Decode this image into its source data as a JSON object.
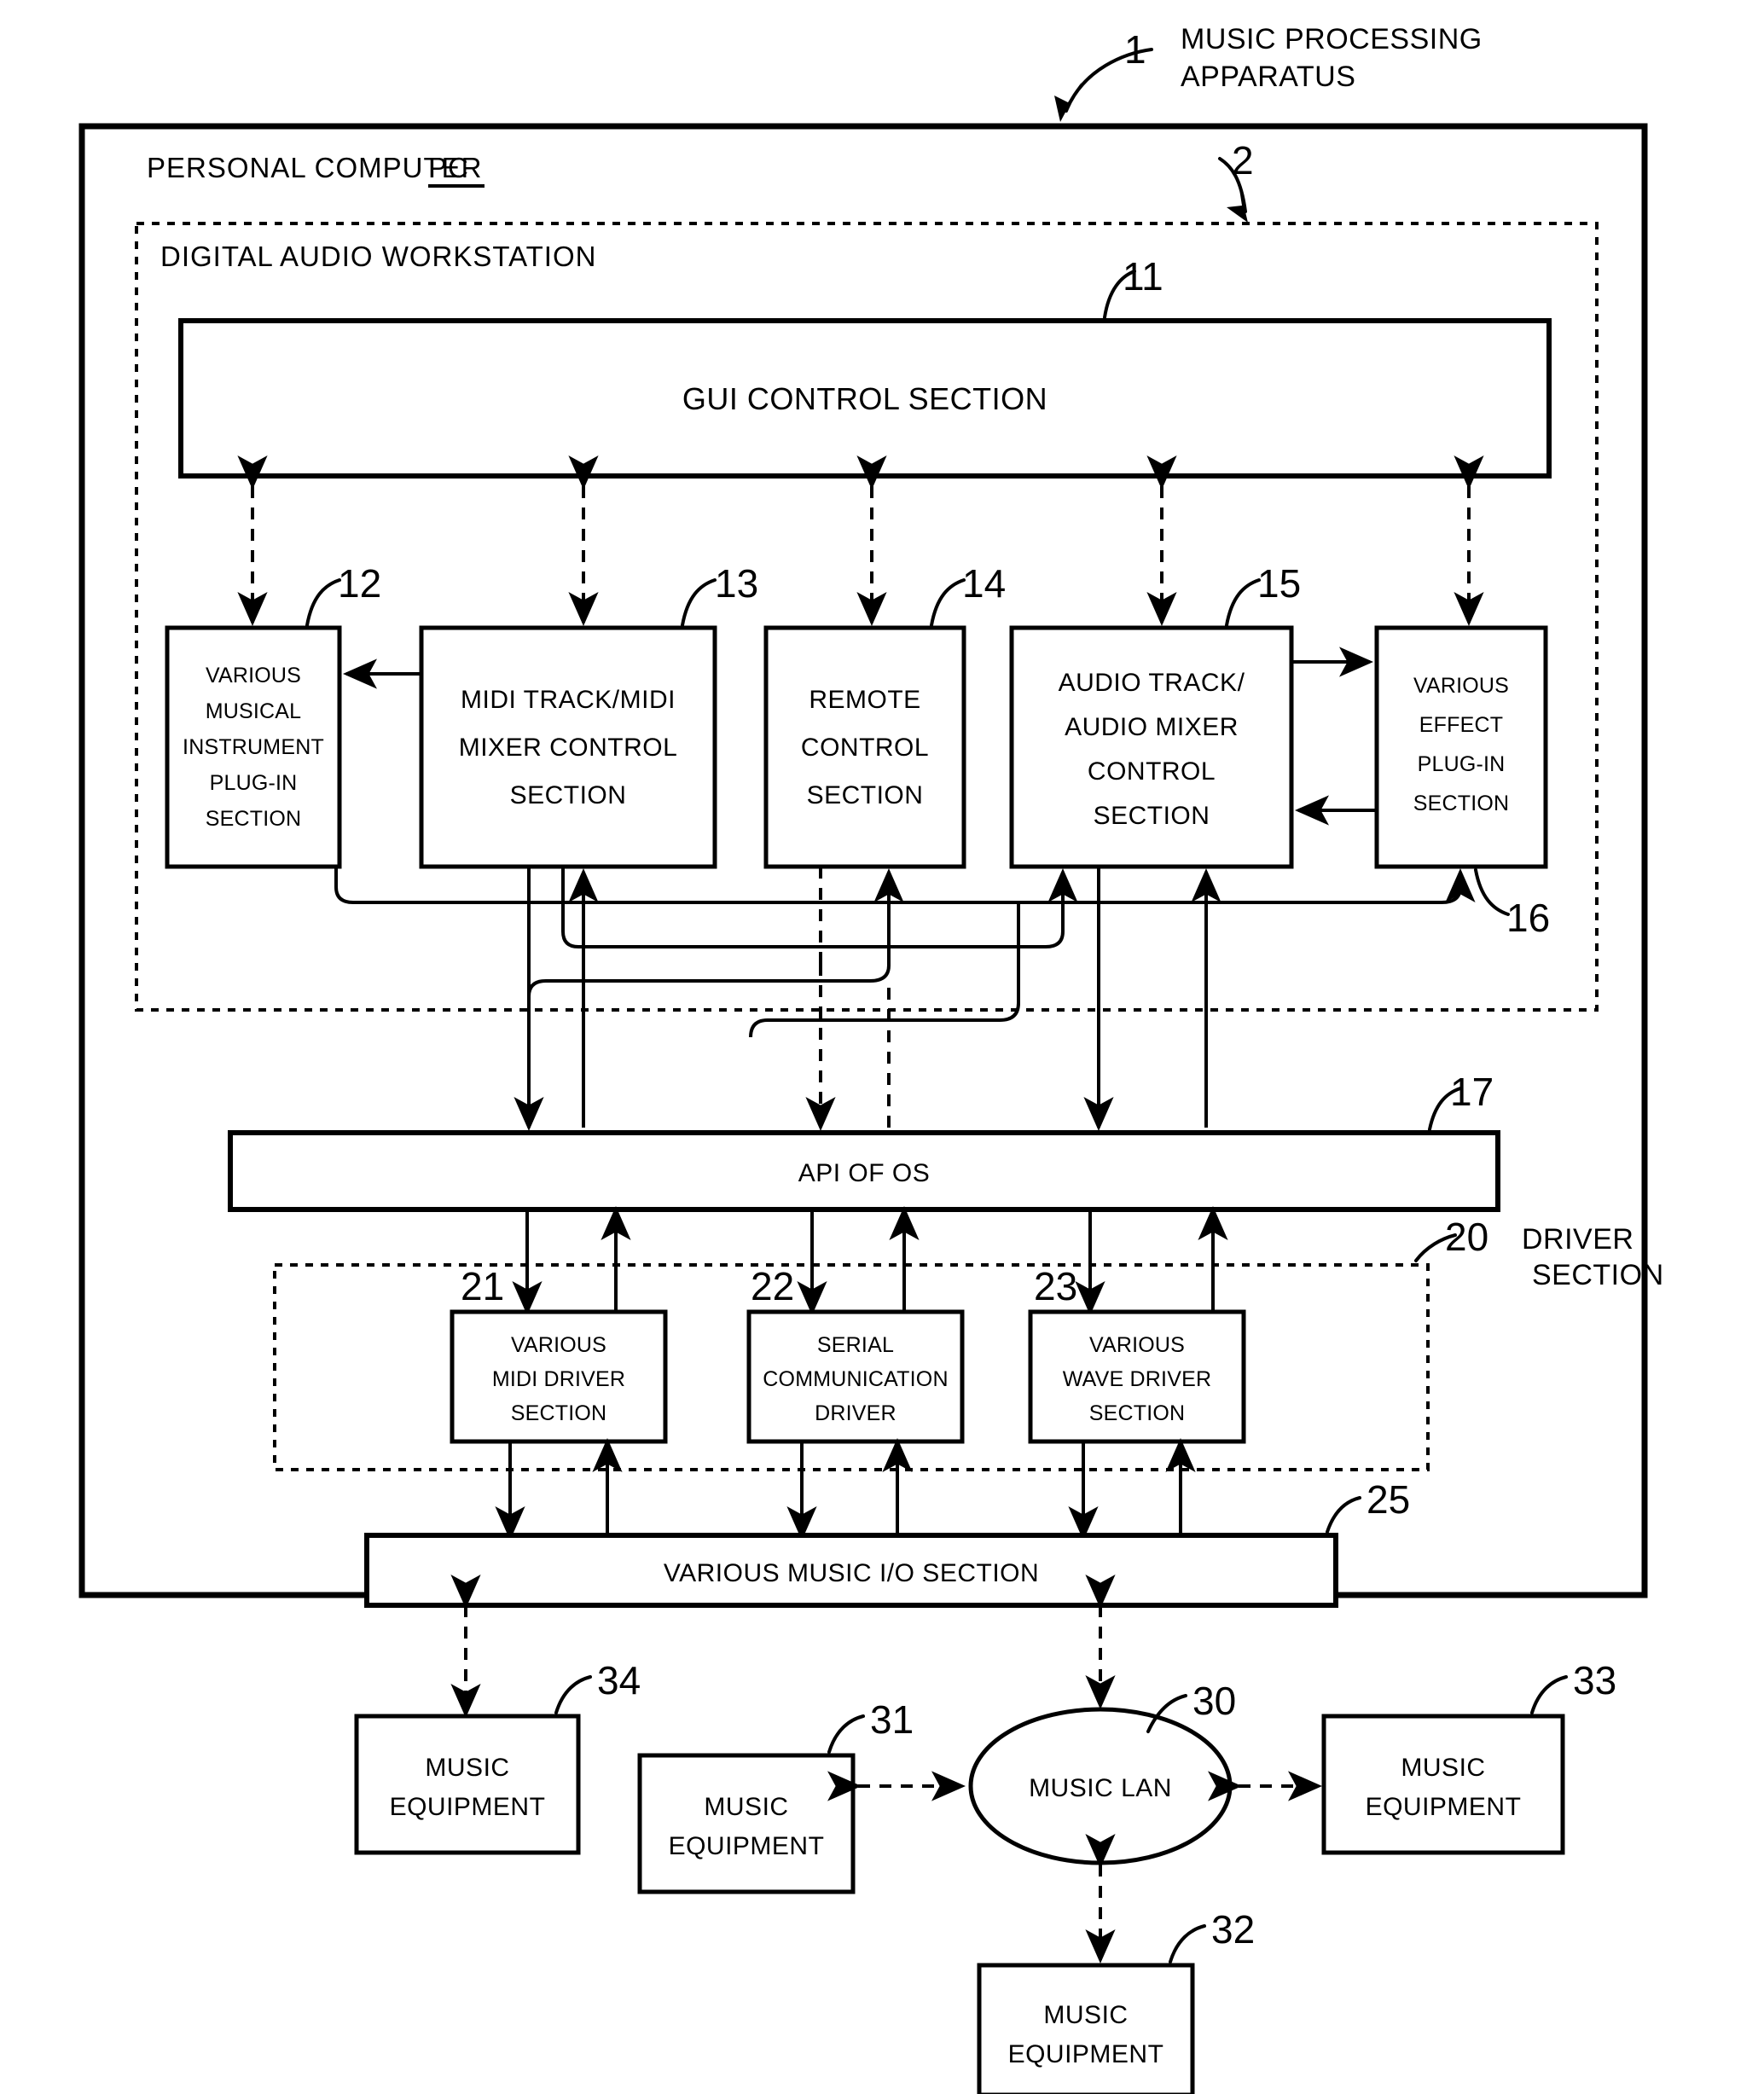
{
  "figure": {
    "title_label": "MUSIC PROCESSING APPARATUS",
    "title_ref": "1",
    "personal_computer_label": "PERSONAL COMPUTER",
    "personal_computer_abbr": "PC",
    "daw_label": "DIGITAL AUDIO WORKSTATION",
    "daw_ref": "2",
    "driver_section_ref": "20",
    "driver_section_label_line1": "DRIVER",
    "driver_section_label_line2": "SECTION"
  },
  "blocks": {
    "gui": {
      "ref": "11",
      "lines": [
        "GUI CONTROL SECTION"
      ]
    },
    "instrument_plugin": {
      "ref": "12",
      "lines": [
        "VARIOUS",
        "MUSICAL",
        "INSTRUMENT",
        "PLUG-IN",
        "SECTION"
      ]
    },
    "midi_track": {
      "ref": "13",
      "lines": [
        "MIDI TRACK/MIDI",
        "MIXER CONTROL",
        "SECTION"
      ]
    },
    "remote_control": {
      "ref": "14",
      "lines": [
        "REMOTE",
        "CONTROL",
        "SECTION"
      ]
    },
    "audio_track": {
      "ref": "15",
      "lines": [
        "AUDIO TRACK/",
        "AUDIO MIXER",
        "CONTROL",
        "SECTION"
      ]
    },
    "effect_plugin": {
      "ref": "16",
      "lines": [
        "VARIOUS",
        "EFFECT",
        "PLUG-IN",
        "SECTION"
      ]
    },
    "api_os": {
      "ref": "17",
      "lines": [
        "API OF OS"
      ]
    },
    "midi_driver": {
      "ref": "21",
      "lines": [
        "VARIOUS",
        "MIDI DRIVER",
        "SECTION"
      ]
    },
    "serial_driver": {
      "ref": "22",
      "lines": [
        "SERIAL",
        "COMMUNICATION",
        "DRIVER"
      ]
    },
    "wave_driver": {
      "ref": "23",
      "lines": [
        "VARIOUS",
        "WAVE DRIVER",
        "SECTION"
      ]
    },
    "music_io": {
      "ref": "25",
      "lines": [
        "VARIOUS MUSIC I/O SECTION"
      ]
    },
    "music_lan": {
      "ref": "30",
      "lines": [
        "MUSIC LAN"
      ]
    },
    "equipment_31": {
      "ref": "31",
      "lines": [
        "MUSIC",
        "EQUIPMENT"
      ]
    },
    "equipment_32": {
      "ref": "32",
      "lines": [
        "MUSIC",
        "EQUIPMENT"
      ]
    },
    "equipment_33": {
      "ref": "33",
      "lines": [
        "MUSIC",
        "EQUIPMENT"
      ]
    },
    "equipment_34": {
      "ref": "34",
      "lines": [
        "MUSIC",
        "EQUIPMENT"
      ]
    }
  },
  "colors": {
    "ink": "#000000",
    "paper": "#ffffff"
  }
}
